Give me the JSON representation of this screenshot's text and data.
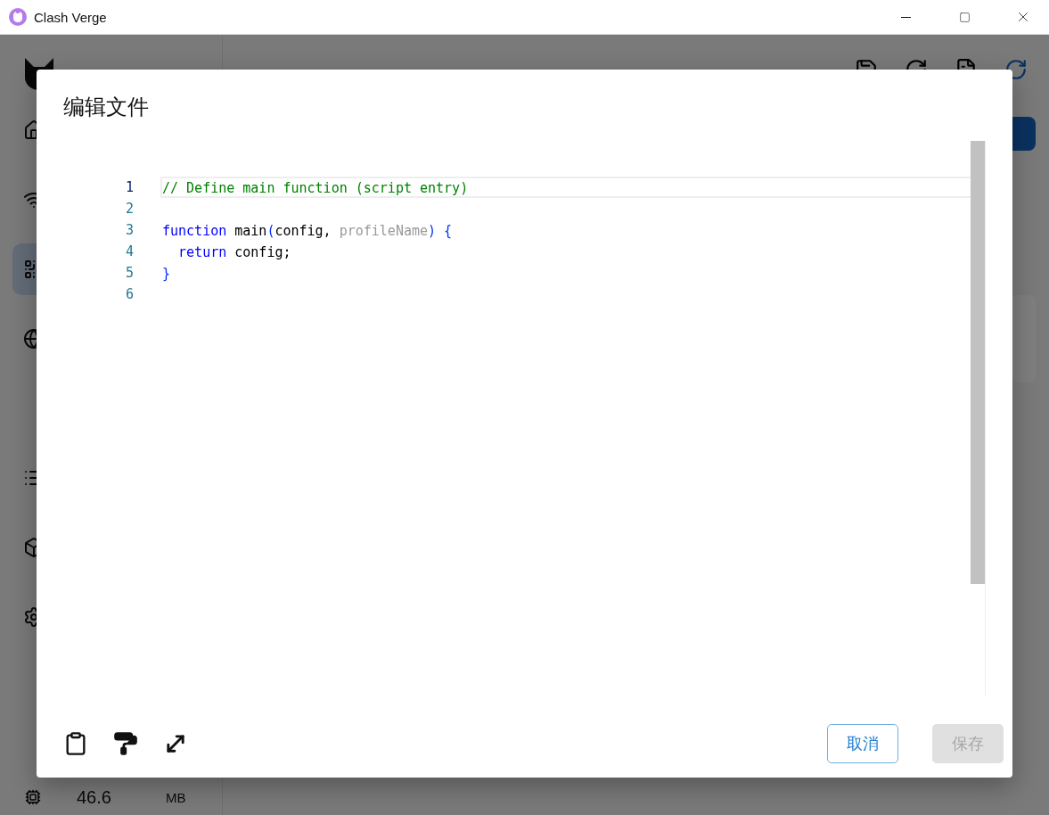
{
  "window": {
    "title": "Clash Verge"
  },
  "sidebar": {
    "items": [
      {
        "selected": false
      },
      {
        "selected": false
      },
      {
        "selected": true
      },
      {
        "selected": false
      },
      {
        "selected": false
      },
      {
        "selected": false
      },
      {
        "selected": false
      },
      {
        "selected": false
      }
    ],
    "memory": {
      "value": "46.6",
      "unit": "MB"
    }
  },
  "dialog": {
    "title": "编辑文件",
    "lines": [
      {
        "number": "1",
        "active": true,
        "tokens": [
          {
            "text": "// Define main function (script entry)",
            "kind": "comment"
          }
        ]
      },
      {
        "number": "2",
        "active": false
      },
      {
        "number": "3",
        "active": false,
        "tokens": [
          {
            "text": "function",
            "kind": "keyword"
          },
          {
            "text": " main",
            "kind": "plain"
          },
          {
            "text": "(",
            "kind": "punct"
          },
          {
            "text": "config, ",
            "kind": "plain"
          },
          {
            "text": "profileName",
            "kind": "param"
          },
          {
            "text": ") {",
            "kind": "punct"
          }
        ]
      },
      {
        "number": "4",
        "active": false,
        "tokens": [
          {
            "text": "  return",
            "kind": "keyword"
          },
          {
            "text": " config;",
            "kind": "plain"
          }
        ]
      },
      {
        "number": "5",
        "active": false,
        "tokens": [
          {
            "text": "}",
            "kind": "punct"
          }
        ]
      },
      {
        "number": "6",
        "active": false
      }
    ],
    "buttons": [
      {
        "label": "取消",
        "kind": "outlined",
        "disabled": false
      },
      {
        "label": "保存",
        "kind": "contained",
        "disabled": true
      }
    ]
  }
}
